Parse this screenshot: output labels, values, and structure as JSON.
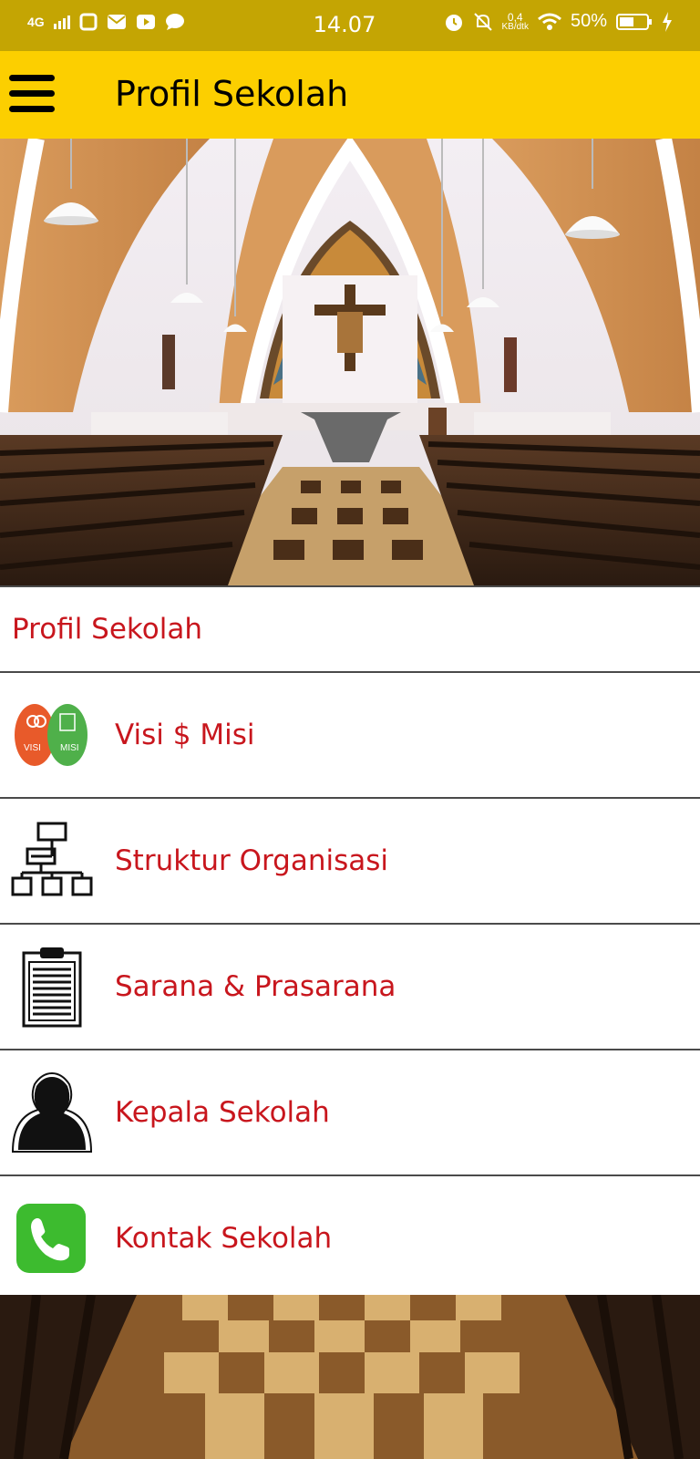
{
  "status_bar": {
    "network": "4G",
    "time": "14.07",
    "data_rate_value": "0,4",
    "data_rate_unit": "KB/dtk",
    "battery": "50%"
  },
  "appbar": {
    "title": "Profil Sekolah"
  },
  "menu": {
    "header": "Profil Sekolah",
    "items": [
      {
        "label": "Visi $ Misi",
        "icon": "visi-misi-icon",
        "icon_text_left": "VISI",
        "icon_text_right": "MISI"
      },
      {
        "label": "Struktur Organisasi",
        "icon": "org-chart-icon"
      },
      {
        "label": "Sarana & Prasarana",
        "icon": "clipboard-icon"
      },
      {
        "label": "Kepala Sekolah",
        "icon": "person-silhouette-icon"
      },
      {
        "label": "Kontak Sekolah",
        "icon": "phone-icon"
      }
    ]
  },
  "colors": {
    "status_bar": "#c4a503",
    "app_bar": "#fccf00",
    "menu_text": "#c8161d",
    "phone_green": "#3dbb2f"
  }
}
